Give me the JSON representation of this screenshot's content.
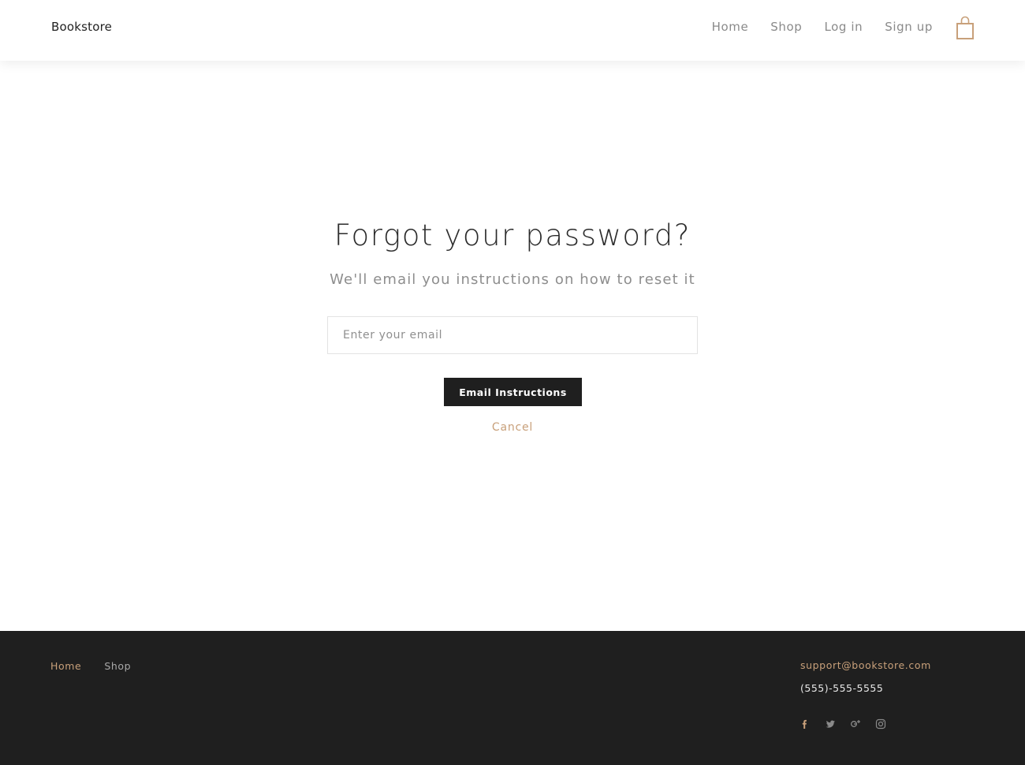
{
  "header": {
    "logo": "Bookstore",
    "nav": [
      {
        "label": "Home"
      },
      {
        "label": "Shop"
      },
      {
        "label": "Log in"
      },
      {
        "label": "Sign up"
      }
    ],
    "cart_icon": "shopping-bag-icon"
  },
  "main": {
    "title": "Forgot your password?",
    "subtitle": "We'll email you instructions on how to reset it",
    "email_placeholder": "Enter your email",
    "submit_label": "Email Instructions",
    "cancel_label": "Cancel"
  },
  "footer": {
    "nav": [
      {
        "label": "Home",
        "active": true
      },
      {
        "label": "Shop",
        "active": false
      }
    ],
    "email": "support@bookstore.com",
    "phone": "(555)-555-5555",
    "social": [
      "facebook-icon",
      "twitter-icon",
      "google-plus-icon",
      "instagram-icon"
    ]
  },
  "colors": {
    "accent": "#c8a07a",
    "dark": "#1f1f1f",
    "muted_text": "#8a8a8a"
  }
}
